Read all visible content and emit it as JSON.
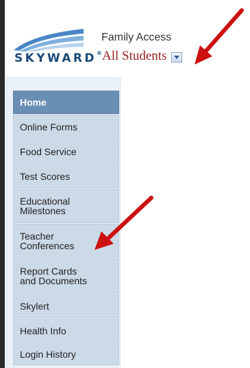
{
  "brand": {
    "logo_text": "SKYWARD",
    "logo_mark": "®"
  },
  "header": {
    "title": "Family Access",
    "student_selector": {
      "selected": "All Students",
      "icon": "chevron-down-icon"
    }
  },
  "sidebar": {
    "items": [
      {
        "label": "Home",
        "active": true
      },
      {
        "label": "Online Forms"
      },
      {
        "label": "Food Service"
      },
      {
        "label": "Test Scores"
      },
      {
        "label": "Educational\nMilestones"
      },
      {
        "label": "Teacher\nConferences"
      },
      {
        "label": "Report Cards\nand Documents"
      },
      {
        "label": "Skylert"
      },
      {
        "label": "Health Info"
      },
      {
        "label": "Login History"
      }
    ]
  },
  "annotations": {
    "arrow_color": "#cc1111"
  },
  "colors": {
    "nav_active_bg": "#6a8fb5",
    "nav_item_bg": "#ccdae8",
    "student_text": "#9a1e1e",
    "logo_blue": "#1a4a7a"
  }
}
